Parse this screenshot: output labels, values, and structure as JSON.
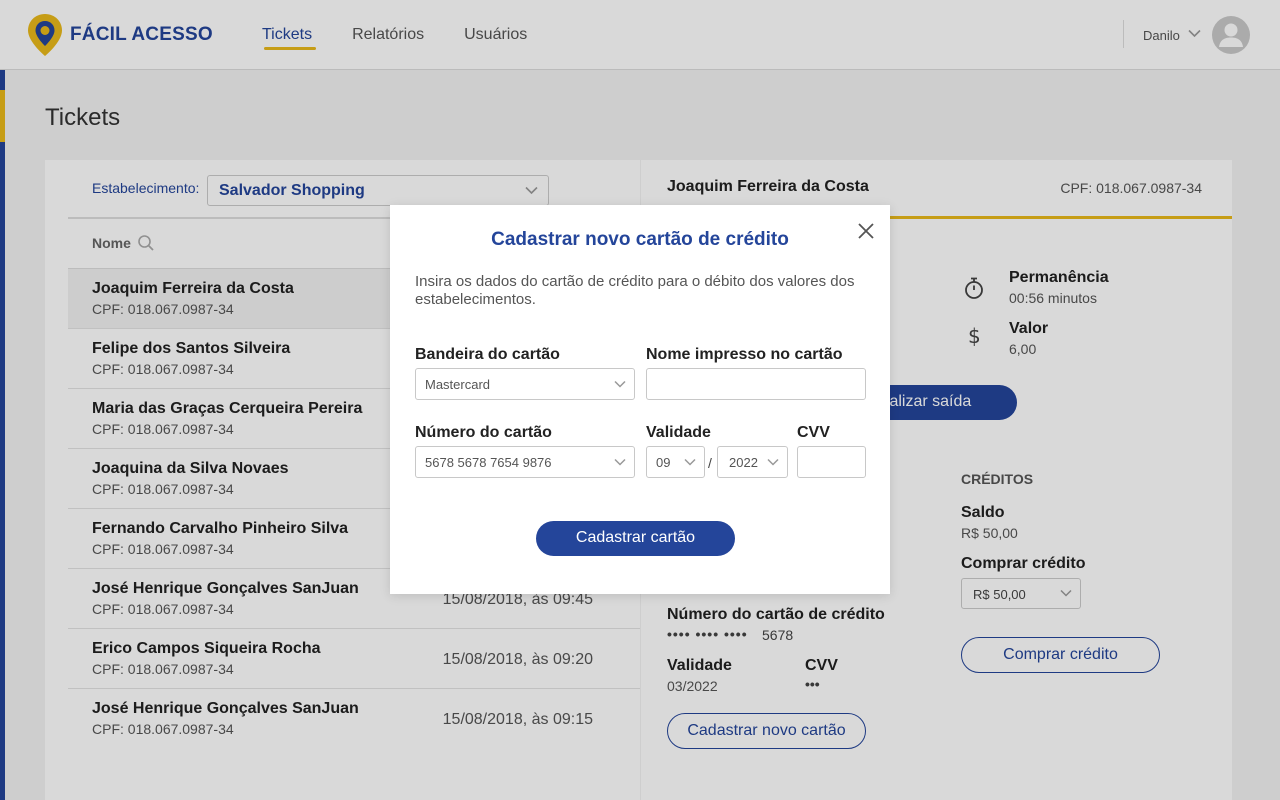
{
  "app": {
    "brand": "FÁCIL ACESSO"
  },
  "nav": {
    "items": [
      {
        "label": "Tickets",
        "active": true
      },
      {
        "label": "Relatórios",
        "active": false
      },
      {
        "label": "Usuários",
        "active": false
      }
    ]
  },
  "user": {
    "name": "Danilo"
  },
  "page": {
    "title": "Tickets"
  },
  "filter": {
    "label": "Estabelecimento:",
    "value": "Salvador Shopping"
  },
  "list": {
    "column_name": "Nome",
    "rows": [
      {
        "name": "Joaquim Ferreira da Costa",
        "cpf": "CPF: 018.067.0987-34",
        "date": ""
      },
      {
        "name": "Felipe dos Santos Silveira",
        "cpf": "CPF: 018.067.0987-34",
        "date": ""
      },
      {
        "name": "Maria das Graças Cerqueira Pereira",
        "cpf": "CPF: 018.067.0987-34",
        "date": ""
      },
      {
        "name": "Joaquina da Silva Novaes",
        "cpf": "CPF: 018.067.0987-34",
        "date": ""
      },
      {
        "name": "Fernando Carvalho Pinheiro Silva",
        "cpf": "CPF: 018.067.0987-34",
        "date": ""
      },
      {
        "name": "José Henrique Gonçalves SanJuan",
        "cpf": "CPF: 018.067.0987-34",
        "date": "15/08/2018, às 09:45"
      },
      {
        "name": "Erico Campos Siqueira Rocha",
        "cpf": "CPF: 018.067.0987-34",
        "date": "15/08/2018, às 09:20"
      },
      {
        "name": "José Henrique Gonçalves SanJuan",
        "cpf": "CPF: 018.067.0987-34",
        "date": "15/08/2018, às 09:15"
      }
    ]
  },
  "detail": {
    "name": "Joaquim Ferreira da Costa",
    "cpf": "CPF: 018.067.0987-34",
    "permanencia_label": "Permanência",
    "permanencia_value": "00:56 minutos",
    "valor_label": "Valor",
    "valor_value": "6,00",
    "finalizar_label": "inalizar saída",
    "creditos_heading": "CRÉDITOS",
    "saldo_label": "Saldo",
    "saldo_value": "R$ 50,00",
    "comprar_label": "Comprar crédito",
    "comprar_select": "R$ 50,00",
    "comprar_button": "Comprar crédito",
    "card_number_label": "Número do cartão de crédito",
    "card_number_masked": "••••   ••••   ••••",
    "card_number_last": "5678",
    "validade_label": "Validade",
    "validade_value": "03/2022",
    "cvv_label": "CVV",
    "cvv_value": "•••",
    "new_card_button": "Cadastrar novo cartão"
  },
  "modal": {
    "title": "Cadastrar novo cartão de crédito",
    "description": "Insira os dados do cartão de crédito para o débito dos valores dos estabelecimentos.",
    "bandeira_label": "Bandeira do cartão",
    "bandeira_value": "Mastercard",
    "nome_label": "Nome impresso no cartão",
    "nome_value": "",
    "numero_label": "Número do cartão",
    "numero_value": "5678 5678 7654 9876",
    "validade_label": "Validade",
    "mes_value": "09",
    "separator": "/",
    "ano_value": "2022",
    "cvv_label": "CVV",
    "cvv_value": "",
    "submit_label": "Cadastrar cartão"
  },
  "colors": {
    "primary": "#24459a",
    "accent": "#e9b91a"
  }
}
